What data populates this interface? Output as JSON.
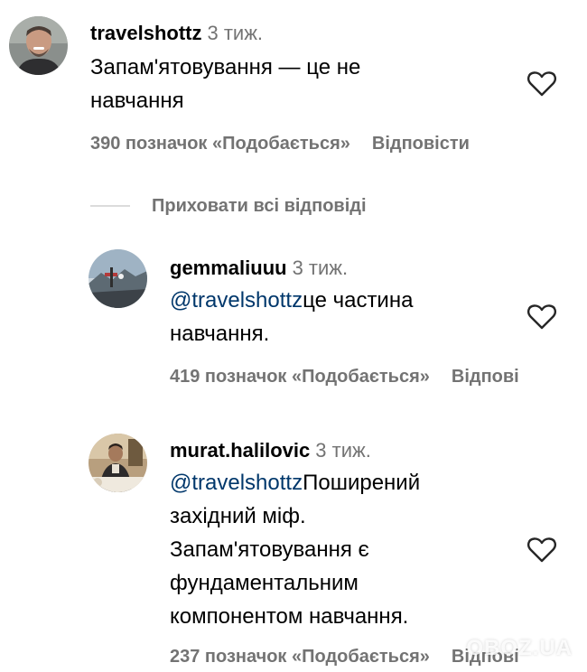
{
  "comments": [
    {
      "username": "travelshottz",
      "time": "3 тиж.",
      "mention": "",
      "lines": [
        "Запам'ятовування — це не",
        "навчання"
      ],
      "likes": "390 позначок «Подобається»",
      "reply": "Відповісти"
    },
    {
      "username": "gemmaliuuu",
      "time": "3 тиж.",
      "mention": "@travelshottz",
      "lines": [
        "це частина",
        "навчання."
      ],
      "likes": "419 позначок «Подобається»",
      "reply": "Відпові"
    },
    {
      "username": "murat.halilovic",
      "time": "3 тиж.",
      "mention": "@travelshottz",
      "lines": [
        "Поширений",
        "західний міф.",
        "Запам'ятовування є",
        "фундаментальним",
        "компонентом навчання."
      ],
      "likes": "237 позначок «Подобається»",
      "reply": "Відпові"
    }
  ],
  "hide_replies": "Приховати всі відповіді",
  "watermark": "OBOZ.UA",
  "icons": {
    "like": "heart-outline-icon"
  },
  "colors": {
    "meta_gray": "#737373",
    "mention_blue": "#00376b",
    "divider": "#dbdbdb"
  }
}
